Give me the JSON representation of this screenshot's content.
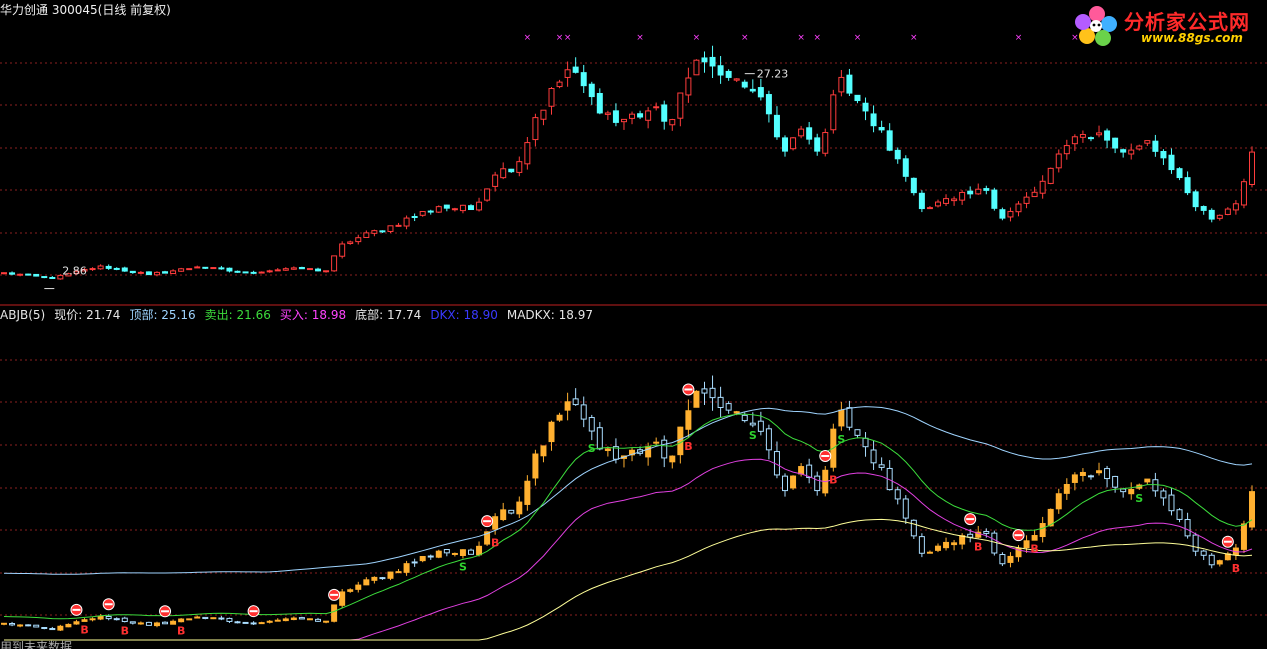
{
  "header": {
    "stock_name": "华力创通",
    "stock_code": "300045",
    "period": "(日线 前复权)"
  },
  "logo": {
    "text": "分析家公式网",
    "url": "www.88gs.com"
  },
  "indicator_header": {
    "name": "ABJB(5)",
    "items": [
      {
        "label": "现价",
        "value": "21.74",
        "color": "#e6e6e6"
      },
      {
        "label": "顶部",
        "value": "25.16",
        "color": "#9fd4ff"
      },
      {
        "label": "卖出",
        "value": "21.66",
        "color": "#3cdc3c"
      },
      {
        "label": "买入",
        "value": "18.98",
        "color": "#ff44ff"
      },
      {
        "label": "底部",
        "value": "17.74",
        "color": "#e6e6e6"
      },
      {
        "label": "DKX",
        "value": "18.90",
        "color": "#3a3aff"
      },
      {
        "label": "MADKX",
        "value": "18.97",
        "color": "#e6e6e6"
      }
    ]
  },
  "bottom_text": "用到未来数据",
  "colors": {
    "up": "#ff3c3c",
    "down": "#54ffff",
    "indicator_candle": "#ffb030",
    "indicator_down": "#aaddff",
    "top_line": "#9fd4ff",
    "sell_line": "#3cdc3c",
    "buy_line": "#e040e0",
    "bottom_line": "#ffff99",
    "grid": "#8a2020",
    "divider": "#c02020",
    "signal_s": "#2fd22f",
    "signal_b": "#ff3030",
    "marker_x": "#ff40ff"
  },
  "chart_data": [
    {
      "type": "candlestick",
      "title": "",
      "ylim": [
        2.0,
        30.0
      ],
      "annotations": [
        {
          "text": "27.23",
          "index": 92,
          "kind": "high"
        },
        {
          "text": "2.86",
          "index": 6,
          "kind": "low"
        }
      ],
      "marker_x_indices": [
        65,
        69,
        70,
        79,
        86,
        92,
        99,
        101,
        106,
        113,
        126,
        133
      ],
      "candle_count": 156,
      "waypoints": [
        {
          "i": 0,
          "close": 3.6
        },
        {
          "i": 6,
          "close": 3.0
        },
        {
          "i": 12,
          "close": 4.3
        },
        {
          "i": 18,
          "close": 3.4
        },
        {
          "i": 24,
          "close": 4.2
        },
        {
          "i": 30,
          "close": 3.6
        },
        {
          "i": 36,
          "close": 4.1
        },
        {
          "i": 40,
          "close": 3.8
        },
        {
          "i": 42,
          "close": 6.6
        },
        {
          "i": 48,
          "close": 8.5
        },
        {
          "i": 54,
          "close": 10.5
        },
        {
          "i": 58,
          "close": 10.2
        },
        {
          "i": 61,
          "close": 13.8
        },
        {
          "i": 64,
          "close": 15.2
        },
        {
          "i": 66,
          "close": 19.8
        },
        {
          "i": 70,
          "close": 24.8
        },
        {
          "i": 73,
          "close": 22.0
        },
        {
          "i": 76,
          "close": 19.3
        },
        {
          "i": 80,
          "close": 20.5
        },
        {
          "i": 83,
          "close": 19.6
        },
        {
          "i": 86,
          "close": 25.8
        },
        {
          "i": 90,
          "close": 24.0
        },
        {
          "i": 92,
          "close": 23.0
        },
        {
          "i": 95,
          "close": 20.2
        },
        {
          "i": 97,
          "close": 16.3
        },
        {
          "i": 99,
          "close": 18.6
        },
        {
          "i": 101,
          "close": 16.3
        },
        {
          "i": 104,
          "close": 24.0
        },
        {
          "i": 107,
          "close": 20.5
        },
        {
          "i": 111,
          "close": 15.5
        },
        {
          "i": 114,
          "close": 10.3
        },
        {
          "i": 118,
          "close": 11.3
        },
        {
          "i": 122,
          "close": 12.2
        },
        {
          "i": 124,
          "close": 9.3
        },
        {
          "i": 128,
          "close": 12.0
        },
        {
          "i": 133,
          "close": 17.8
        },
        {
          "i": 136,
          "close": 18.2
        },
        {
          "i": 139,
          "close": 16.2
        },
        {
          "i": 142,
          "close": 17.4
        },
        {
          "i": 144,
          "close": 15.6
        },
        {
          "i": 148,
          "close": 10.5
        },
        {
          "i": 150,
          "close": 9.2
        },
        {
          "i": 153,
          "close": 10.8
        },
        {
          "i": 155,
          "close": 16.2
        }
      ]
    },
    {
      "type": "line",
      "title": "ABJB(5)",
      "ylim": [
        14.0,
        28.0
      ],
      "series": [
        {
          "name": "顶部",
          "value_last": 25.16
        },
        {
          "name": "卖出",
          "value_last": 21.66
        },
        {
          "name": "买入",
          "value_last": 18.98
        },
        {
          "name": "底部",
          "value_last": 17.74
        }
      ],
      "signals": [
        {
          "type": "sell",
          "index": 9
        },
        {
          "type": "sell",
          "index": 13
        },
        {
          "type": "sell",
          "index": 20
        },
        {
          "type": "sell",
          "index": 31
        },
        {
          "type": "sell",
          "index": 41
        },
        {
          "type": "sell",
          "index": 60
        },
        {
          "type": "sell",
          "index": 85
        },
        {
          "type": "sell",
          "index": 102
        },
        {
          "type": "sell",
          "index": 120
        },
        {
          "type": "sell",
          "index": 126
        },
        {
          "type": "sell",
          "index": 152
        },
        {
          "type": "buy",
          "index": 10
        },
        {
          "type": "buy",
          "index": 15
        },
        {
          "type": "buy",
          "index": 22
        },
        {
          "type": "buy",
          "index": 61
        },
        {
          "type": "buy",
          "index": 85
        },
        {
          "type": "buy",
          "index": 103
        },
        {
          "type": "buy",
          "index": 121
        },
        {
          "type": "buy",
          "index": 128
        },
        {
          "type": "buy",
          "index": 153
        },
        {
          "type": "s_green",
          "index": 73
        },
        {
          "type": "s_green",
          "index": 57
        },
        {
          "type": "s_green",
          "index": 93
        },
        {
          "type": "s_green",
          "index": 104
        },
        {
          "type": "s_green",
          "index": 141
        }
      ]
    }
  ]
}
